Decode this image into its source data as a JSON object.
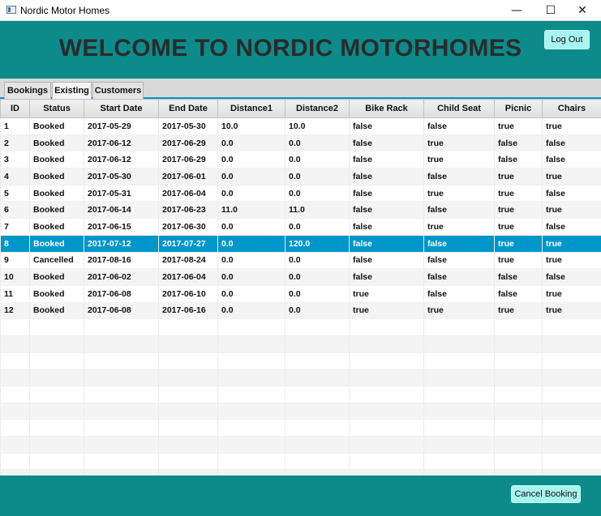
{
  "window": {
    "title": "Nordic Motor Homes",
    "minimize": "—",
    "maximize": "☐",
    "close": "✕"
  },
  "header": {
    "title": "WELCOME TO NORDIC MOTORHOMES",
    "logout_label": "Log Out"
  },
  "tabs": [
    {
      "label": "Bookings",
      "active": false
    },
    {
      "label": "Existing",
      "active": true
    },
    {
      "label": "Customers",
      "active": false
    }
  ],
  "table": {
    "columns": [
      "ID",
      "Status",
      "Start Date",
      "End Date",
      "Distance1",
      "Distance2",
      "Bike Rack",
      "Child Seat",
      "Picnic",
      "Chairs"
    ],
    "rows": [
      [
        "1",
        "Booked",
        "2017-05-29",
        "2017-05-30",
        "10.0",
        "10.0",
        "false",
        "false",
        "true",
        "true"
      ],
      [
        "2",
        "Booked",
        "2017-06-12",
        "2017-06-29",
        "0.0",
        "0.0",
        "false",
        "true",
        "false",
        "false"
      ],
      [
        "3",
        "Booked",
        "2017-06-12",
        "2017-06-29",
        "0.0",
        "0.0",
        "false",
        "true",
        "false",
        "false"
      ],
      [
        "4",
        "Booked",
        "2017-05-30",
        "2017-06-01",
        "0.0",
        "0.0",
        "false",
        "false",
        "true",
        "true"
      ],
      [
        "5",
        "Booked",
        "2017-05-31",
        "2017-06-04",
        "0.0",
        "0.0",
        "false",
        "true",
        "true",
        "false"
      ],
      [
        "6",
        "Booked",
        "2017-06-14",
        "2017-06-23",
        "11.0",
        "11.0",
        "false",
        "false",
        "true",
        "true"
      ],
      [
        "7",
        "Booked",
        "2017-06-15",
        "2017-06-30",
        "0.0",
        "0.0",
        "false",
        "true",
        "true",
        "false"
      ],
      [
        "8",
        "Booked",
        "2017-07-12",
        "2017-07-27",
        "0.0",
        "120.0",
        "false",
        "false",
        "true",
        "true"
      ],
      [
        "9",
        "Cancelled",
        "2017-08-16",
        "2017-08-24",
        "0.0",
        "0.0",
        "false",
        "false",
        "true",
        "true"
      ],
      [
        "10",
        "Booked",
        "2017-06-02",
        "2017-06-04",
        "0.0",
        "0.0",
        "false",
        "false",
        "false",
        "false"
      ],
      [
        "11",
        "Booked",
        "2017-06-08",
        "2017-06-10",
        "0.0",
        "0.0",
        "true",
        "false",
        "false",
        "true"
      ],
      [
        "12",
        "Booked",
        "2017-06-08",
        "2017-06-16",
        "0.0",
        "0.0",
        "true",
        "true",
        "true",
        "true"
      ]
    ],
    "selected_row": 8
  },
  "footer": {
    "cancel_label": "Cancel Booking"
  },
  "colors": {
    "header_bg": "#0d8b8b",
    "button_bg": "#a8f5f0",
    "selection": "#0096c9"
  }
}
